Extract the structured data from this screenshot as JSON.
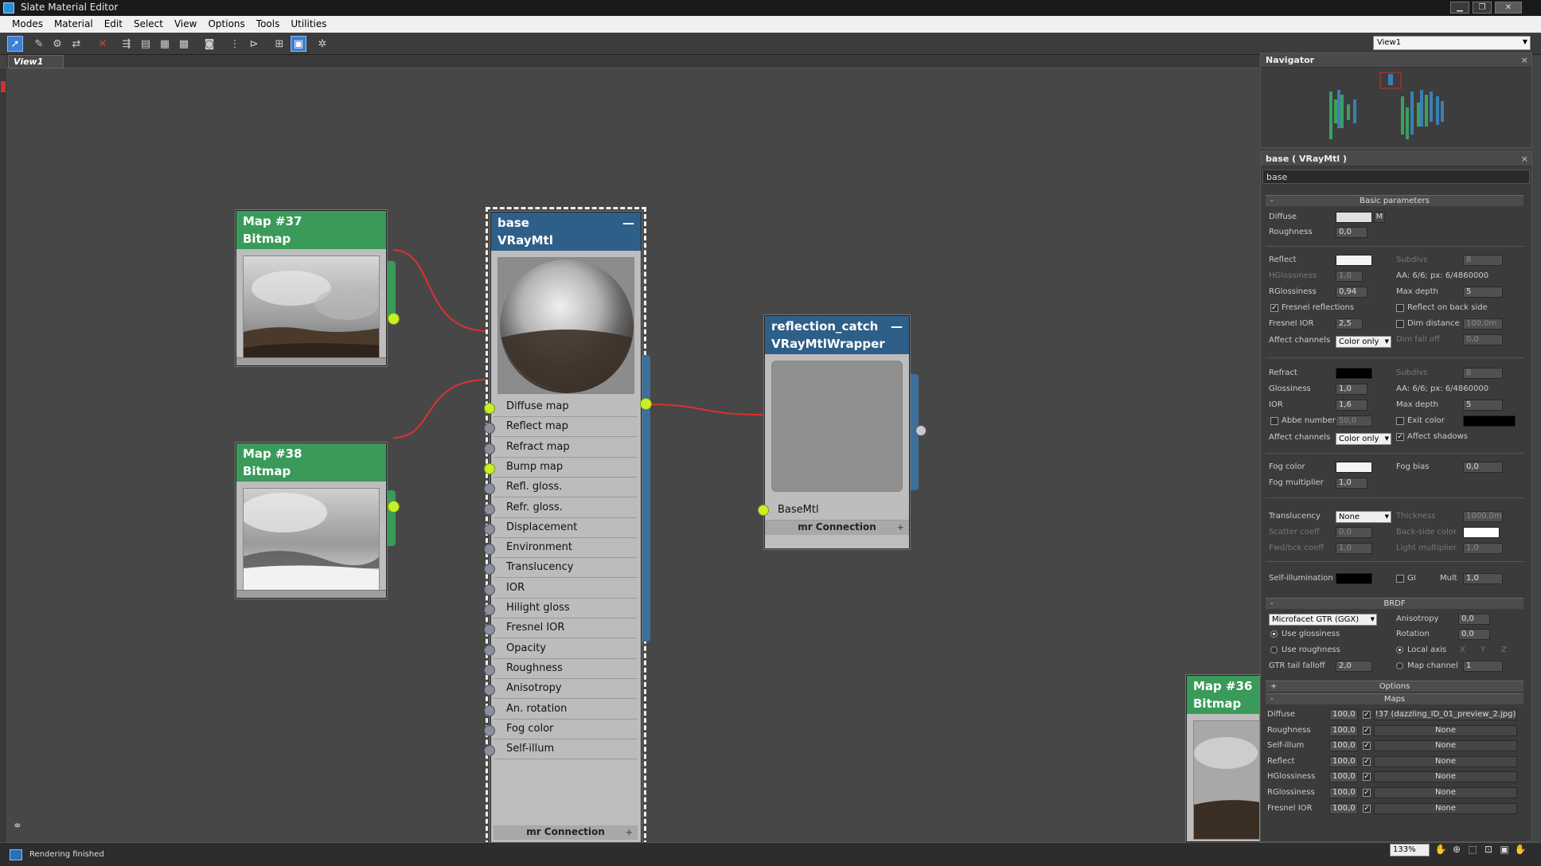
{
  "window": {
    "title": "Slate Material Editor"
  },
  "menu": [
    "Modes",
    "Material",
    "Edit",
    "Select",
    "View",
    "Options",
    "Tools",
    "Utilities"
  ],
  "toolbar": {
    "view_select": "View1"
  },
  "tabs": [
    "View1"
  ],
  "nodes": {
    "map37": {
      "name": "Map #37",
      "type": "Bitmap"
    },
    "map38": {
      "name": "Map #38",
      "type": "Bitmap"
    },
    "map36": {
      "name": "Map #36",
      "type": "Bitmap"
    },
    "base": {
      "name": "base",
      "type": "VRayMtl",
      "slots": [
        "Diffuse map",
        "Reflect map",
        "Refract map",
        "Bump map",
        "Refl. gloss.",
        "Refr. gloss.",
        "Displacement",
        "Environment",
        "Translucency",
        "IOR",
        "Hilight gloss",
        "Fresnel IOR",
        "Opacity",
        "Roughness",
        "Anisotropy",
        "An. rotation",
        "Fog color",
        "Self-illum"
      ],
      "connected": [
        0,
        3
      ],
      "footer": "mr Connection"
    },
    "wrapper": {
      "name": "reflection_catch",
      "type": "VRayMtlWrapper",
      "slot": "BaseMtl",
      "footer": "mr Connection"
    }
  },
  "navigator": {
    "title": "Navigator"
  },
  "props": {
    "title": "base  ( VRayMtl )",
    "name": "base",
    "rollouts": {
      "basic": "Basic parameters",
      "brdf": "BRDF",
      "options": "Options",
      "maps": "Maps"
    },
    "basic": {
      "diffuse_label": "Diffuse",
      "diffuse_btn": "M",
      "roughness_label": "Roughness",
      "roughness": "0,0",
      "reflect_label": "Reflect",
      "subdivs_label": "Subdivs",
      "subdivs": "8",
      "hgloss_label": "HGlossiness",
      "hgloss": "1,0",
      "aa_text": "AA: 6/6; px: 6/4860000",
      "rgloss_label": "RGlossiness",
      "rgloss": "0,94",
      "maxdepth_label": "Max depth",
      "maxdepth": "5",
      "fresnel_label": "Fresnel reflections",
      "backside_label": "Reflect on back side",
      "fresnel_ior_label": "Fresnel IOR",
      "fresnel_ior": "2,5",
      "dimdist_label": "Dim distance",
      "dimdist": "100,0m",
      "affect_label": "Affect channels",
      "affect": "Color only",
      "dimfall_label": "Dim fall off",
      "dimfall": "0,0",
      "refract_label": "Refract",
      "r_subdivs": "8",
      "glossiness_label": "Glossiness",
      "glossiness": "1,0",
      "r_aa_text": "AA: 6/6; px: 6/4860000",
      "ior_label": "IOR",
      "ior": "1,6",
      "r_maxdepth": "5",
      "abbe_label": "Abbe number",
      "abbe": "50,0",
      "exit_label": "Exit color",
      "affect2": "Color only",
      "affect_shadows_label": "Affect shadows",
      "fog_label": "Fog color",
      "fogbias_label": "Fog bias",
      "fogbias": "0,0",
      "fogmult_label": "Fog multiplier",
      "fogmult": "1,0",
      "transl_label": "Translucency",
      "transl": "None",
      "thickness_label": "Thickness",
      "thickness": "1000,0m",
      "scatter_label": "Scatter coeff",
      "scatter": "0,0",
      "backside_color_label": "Back-side color",
      "fwd_label": "Fwd/bck coeff",
      "fwd": "1,0",
      "lightmult_label": "Light multiplier",
      "lightmult": "1,0",
      "selfillum_label": "Self-illumination",
      "gi_label": "GI",
      "mult_label": "Mult",
      "mult": "1,0"
    },
    "brdf": {
      "type": "Microfacet GTR (GGX)",
      "aniso_label": "Anisotropy",
      "aniso": "0,0",
      "rotation_label": "Rotation",
      "rotation": "0,0",
      "use_gloss": "Use glossiness",
      "use_rough": "Use roughness",
      "local_axis": "Local axis",
      "x": "X",
      "y": "Y",
      "z": "Z",
      "gtr_label": "GTR tail falloff",
      "gtr": "2,0",
      "mapch_label": "Map channel",
      "mapch": "1"
    },
    "maps": [
      {
        "label": "Diffuse",
        "amount": "100,0",
        "map": "!37 (dazzling_ID_01_preview_2.jpg)"
      },
      {
        "label": "Roughness",
        "amount": "100,0",
        "map": "None"
      },
      {
        "label": "Self-illum",
        "amount": "100,0",
        "map": "None"
      },
      {
        "label": "Reflect",
        "amount": "100,0",
        "map": "None"
      },
      {
        "label": "HGlossiness",
        "amount": "100,0",
        "map": "None"
      },
      {
        "label": "RGlossiness",
        "amount": "100,0",
        "map": "None"
      },
      {
        "label": "Fresnel IOR",
        "amount": "100,0",
        "map": "None"
      }
    ]
  },
  "status": {
    "text": "Rendering finished",
    "zoom": "133%"
  },
  "colors": {
    "green_header": "#3a9a5a",
    "blue_header": "#2e5f88",
    "wire": "#e03030",
    "socket_on": "#c8f028"
  }
}
